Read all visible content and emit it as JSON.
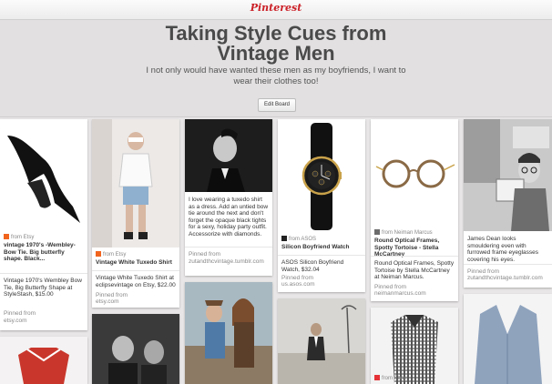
{
  "app": {
    "logo": "Pinterest"
  },
  "board": {
    "title": "Taking Style Cues from Vintage Men",
    "description": "I not only would have wanted these men as my boyfriends, I want to wear their clothes too!",
    "edit_label": "Edit Board"
  },
  "pins": {
    "p1": {
      "source": "from Etsy",
      "title": "vintage 1970's -Wembley- Bow Tie. Big butterfly shape. Black...",
      "desc": "Vintage 1970's Wembley Bow Tie, Big Butterfly Shape at StyleStash, $15.00",
      "pinned_label": "Pinned from",
      "pinned_site": "etsy.com"
    },
    "p2": {
      "source": "from Etsy",
      "title": "Vintage White Tuxedo Shirt",
      "desc": "Vintage White Tuxedo Shirt at eclipsevintage on Etsy, $22.00",
      "pinned_label": "Pinned from",
      "pinned_site": "etsy.com"
    },
    "p3": {
      "desc": "I love wearing a tuxedo shirt as a dress. Add an untied bow tie around the next and don't forget the opaque black tights for a sexy, holiday party outfit. Accessorize with diamonds.",
      "pinned_label": "Pinned from",
      "pinned_site": "zutandthcvintage.tumblr.com"
    },
    "p4": {
      "source": "from ASOS",
      "title": "Silicon Boyfriend Watch",
      "desc": "ASOS Silicon Boyfriend Watch, $32.04",
      "pinned_label": "Pinned from",
      "pinned_site": "us.asos.com"
    },
    "p5": {
      "source": "from Neiman Marcus",
      "title": "Round Optical Frames, Spotty Tortoise - Stella McCartney",
      "desc": "Round Optical Frames, Spotty Tortoise by Stella McCartney at Neiman Marcus.",
      "pinned_label": "Pinned from",
      "pinned_site": "neimanmarcus.com"
    },
    "p6": {
      "desc": "James Dean looks smouldering even with furrowed frame eyeglasses covering his eyes.",
      "pinned_label": "Pinned from",
      "pinned_site": "zutandthcvintage.tumblr.com"
    },
    "p9": {
      "source": "from Ebay"
    }
  },
  "colors": {
    "brand": "#cb2027",
    "etsy": "#f1641e",
    "asos": "#222222",
    "neiman": "#6b6b6b"
  }
}
